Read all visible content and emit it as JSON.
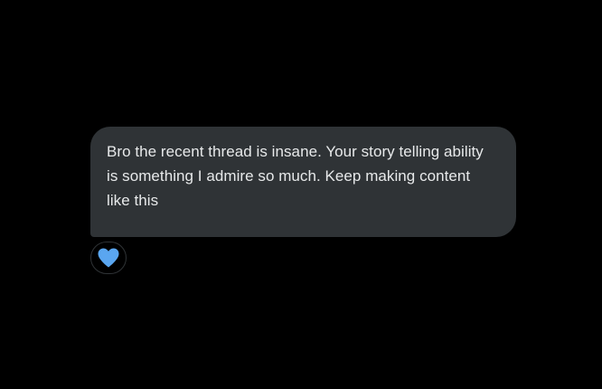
{
  "message": {
    "text": "Bro the recent thread is insane. Your story telling ability is something I admire so much. Keep making content like this",
    "bubble_color": "#2f3336",
    "text_color": "#e7e9ea"
  },
  "reaction": {
    "icon": "blue-heart-icon",
    "color": "#5aa6f0"
  },
  "background_color": "#000000"
}
